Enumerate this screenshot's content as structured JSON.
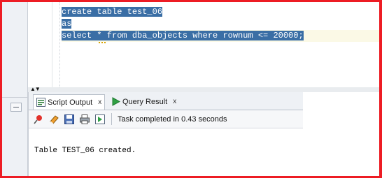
{
  "editor": {
    "lines": [
      "create table test_06",
      "as",
      "select * from dba_objects where rownum <= 20000;"
    ]
  },
  "output_panel": {
    "tabs": [
      {
        "label": "Script Output",
        "close": "x",
        "icon": "script-output-icon"
      },
      {
        "label": "Query Result",
        "close": "x",
        "icon": "play-arrow-icon"
      }
    ],
    "toolbar_icons": [
      "pin-icon",
      "eraser-icon",
      "save-icon",
      "print-icon",
      "export-icon"
    ],
    "status": "Task completed in 0.43 seconds",
    "output": "Table TEST_06 created."
  },
  "colors": {
    "border": "#ed1c24",
    "selection": "#3a6ea5",
    "current_line": "#fbf9e6"
  }
}
